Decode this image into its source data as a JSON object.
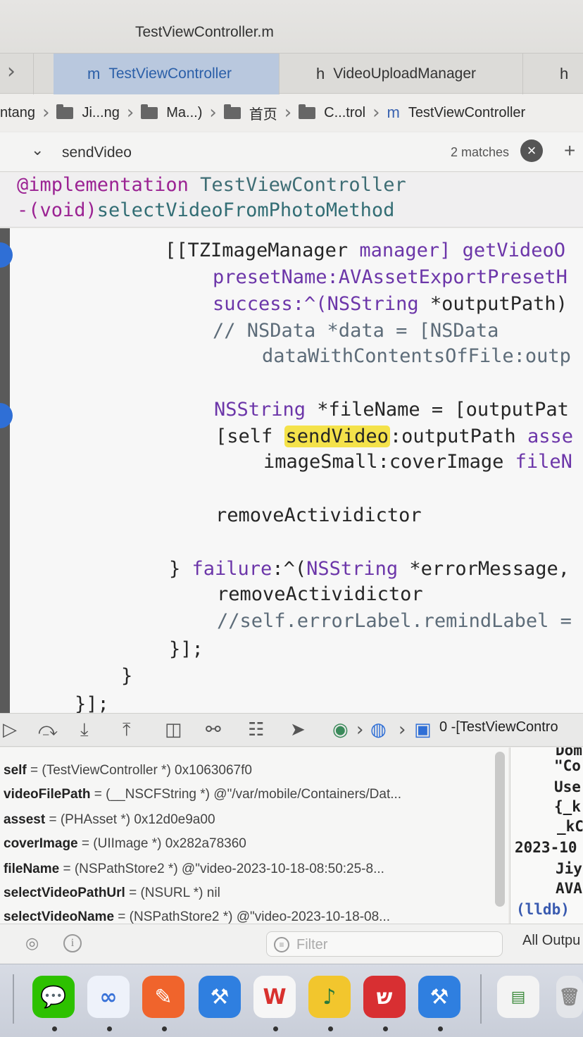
{
  "window": {
    "title": "TestViewController.m"
  },
  "tabs": [
    {
      "glyph": "m",
      "label": "TestViewController",
      "active": true
    },
    {
      "glyph": "h",
      "label": "VideoUploadManager",
      "active": false
    },
    {
      "glyph": "h",
      "label": "",
      "active": false
    }
  ],
  "breadcrumb": {
    "items": [
      "ntang",
      "Ji...ng",
      "Ma...)",
      "首页",
      "C...trol",
      "TestViewController"
    ]
  },
  "find": {
    "query": "sendVideo",
    "matches": "2 matches"
  },
  "scope_header": {
    "line1_kw": "@implementation",
    "line1_cls": "TestViewController",
    "line2_kw": "-(void)",
    "line2_fn": "selectVideoFromPhotoMethod"
  },
  "code": {
    "l1a": "[[TZImageManager ",
    "l1b": "manager] ",
    "l1c": "getVideoO",
    "l2": "presetName:AVAssetExportPresetH",
    "l3a": "success:^(",
    "l3b": "NSString",
    "l3c": " *outputPath)",
    "l4": "// NSData *data = [NSData",
    "l5": "dataWithContentsOfFile:outp",
    "l6a": "NSString",
    "l6b": " *fileName = [outputPat",
    "l7a": "[self ",
    "l7b": "sendVideo",
    "l7c": ":outputPath ",
    "l7d": "asse",
    "l8a": "imageSmall",
    "l8b": ":coverImage ",
    "l8c": "fileN",
    "l9": "removeActividictor",
    "l10a": "} ",
    "l10b": "failure",
    "l10c": ":^(",
    "l10d": "NSString",
    "l10e": " *errorMessage,",
    "l11": "removeActividictor",
    "l12": "//self.errorLabel.remindLabel =",
    "l13": "}];",
    "l14": "}",
    "l15": "}];"
  },
  "debug_bar": {
    "frame": "0 -[TestViewContro"
  },
  "variables": [
    {
      "name": "self",
      "value": " = (TestViewController *) 0x1063067f0"
    },
    {
      "name": "videoFilePath",
      "value": " = (__NSCFString *) @\"/var/mobile/Containers/Dat..."
    },
    {
      "name": "assest",
      "value": " = (PHAsset *) 0x12d0e9a00"
    },
    {
      "name": "coverImage",
      "value": " = (UIImage *) 0x282a78360"
    },
    {
      "name": "fileName",
      "value": " = (NSPathStore2 *) @\"video-2023-10-18-08:50:25-8..."
    },
    {
      "name": "selectVideoPathUrl",
      "value": " = (NSURL *) nil"
    },
    {
      "name": "selectVideoName",
      "value": " = (NSPathStore2 *) @\"video-2023-10-18-08..."
    }
  ],
  "console": {
    "lines": [
      "Dom",
      "\"Co",
      "Use",
      "{_k",
      "_kC",
      "2023-10",
      "Jiy",
      "AVA",
      "(lldb)"
    ]
  },
  "bottom": {
    "filter_placeholder": "Filter",
    "output_label": "All Outpu"
  },
  "dock": {
    "apps": [
      {
        "icon": "wechat-icon",
        "color": "#2dc100"
      },
      {
        "icon": "baidu-netdisk-icon",
        "color": "#e8eef8"
      },
      {
        "icon": "pen-app-icon",
        "color": "#f0642c"
      },
      {
        "icon": "xcode-instruments-icon",
        "color": "#2f7fe0"
      },
      {
        "icon": "wps-icon",
        "color": "#f4f4f4"
      },
      {
        "icon": "music-app-icon",
        "color": "#f2c62d"
      },
      {
        "icon": "red-app-icon",
        "color": "#d82f32"
      },
      {
        "icon": "xcode-icon",
        "color": "#2f7fe0"
      }
    ]
  }
}
